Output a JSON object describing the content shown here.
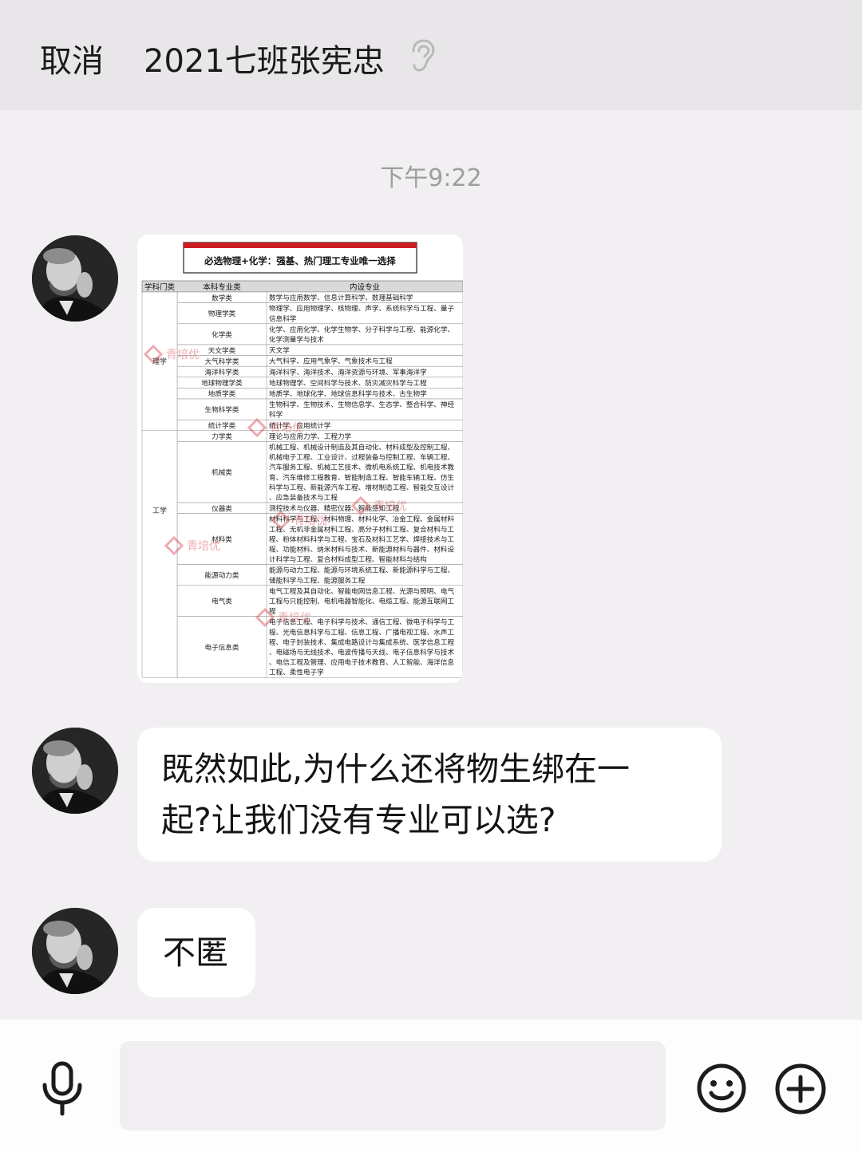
{
  "header": {
    "back_label": "取消",
    "title": "2021七班张宪忠",
    "mode_icon": "ear-icon"
  },
  "conversation": {
    "timestamp": "下午9:22",
    "messages": [
      {
        "type": "image",
        "image": {
          "banner": "必选物理+化学：强基、热门理工专业唯一选择",
          "columns": [
            "学科门类",
            "本科专业类",
            "内设专业"
          ],
          "watermark": "青培优",
          "rows": [
            [
              "理学",
              "数学类",
              "数学与应用数学、信息计算科学、数理基础科学"
            ],
            [
              "",
              "物理学类",
              "物理学、应用物理学、核物理、声学、系统科学与工程、量子信息科学"
            ],
            [
              "",
              "化学类",
              "化学、应用化学、化学生物学、分子科学与工程、能源化学、化学测量学与技术"
            ],
            [
              "",
              "天文学类",
              "天文学"
            ],
            [
              "",
              "大气科学类",
              "大气科学、应用气象学、气象技术与工程"
            ],
            [
              "",
              "海洋科学类",
              "海洋科学、海洋技术、海洋资源与环境、军事海洋学"
            ],
            [
              "",
              "地球物理学类",
              "地球物理学、空间科学与技术、防灾减灾科学与工程"
            ],
            [
              "",
              "地质学类",
              "地质学、地球化学、地球信息科学与技术、古生物学"
            ],
            [
              "",
              "生物科学类",
              "生物科学、生物技术、生物信息学、生态学、整合科学、神经科学"
            ],
            [
              "",
              "统计学类",
              "统计学、应用统计学"
            ],
            [
              "工学",
              "力学类",
              "理论与应用力学、工程力学"
            ],
            [
              "",
              "机械类",
              "机械工程、机械设计制造及其自动化、材料成型及控制工程、机械电子工程、工业设计、过程装备与控制工程、车辆工程、汽车服务工程、机械工艺技术、微机电系统工程、机电技术教育、汽车维修工程教育、智能制造工程、智能车辆工程、仿生科学与工程、新能源汽车工程、增材制造工程、智能交互设计、应急装备技术与工程"
            ],
            [
              "",
              "仪器类",
              "测控技术与仪器、精密仪器、智能感知工程"
            ],
            [
              "",
              "材料类",
              "材料科学与工程、材料物理、材料化学、冶金工程、金属材料工程、无机非金属材料工程、高分子材料工程、复合材料与工程、粉体材料科学与工程、宝石及材料工艺学、焊接技术与工程、功能材料、纳米材料与技术、新能源材料与器件、材料设计科学与工程、复合材料成型工程、智能材料与结构"
            ],
            [
              "",
              "能源动力类",
              "能源与动力工程、能源与环境系统工程、新能源科学与工程、储能科学与工程、能源服务工程"
            ],
            [
              "",
              "电气类",
              "电气工程及其自动化、智能电网信息工程、光源与照明、电气工程与只能控制、电机电器智能化、电缆工程、能源互联网工程"
            ],
            [
              "",
              "电子信息类",
              "电子信息工程、电子科学与技术、通信工程、微电子科学与工程、光电信息科学与工程、信息工程、广播电视工程、水声工程、电子封装技术、集成电路设计与集成系统、医学信息工程、电磁场与无线技术、电波传播与天线、电子信息科学与技术、电信工程及管理、应用电子技术教育、人工智能、海洋信息工程、柔性电子学"
            ]
          ]
        }
      },
      {
        "type": "text",
        "lines": [
          "既然如此,为什么还将物生绑在一",
          "起?让我们没有专业可以选?"
        ]
      },
      {
        "type": "text",
        "lines": [
          "不匿"
        ]
      }
    ]
  },
  "footer": {
    "input_value": "",
    "icons": [
      "mic-icon",
      "emoji-icon",
      "plus-icon"
    ]
  },
  "colors": {
    "header_bg": "#e8e6e8",
    "chat_bg": "#f1eff1",
    "bubble_bg": "#ffffff",
    "banner_red": "#cc1f24",
    "watermark": "#e8a0a4"
  }
}
